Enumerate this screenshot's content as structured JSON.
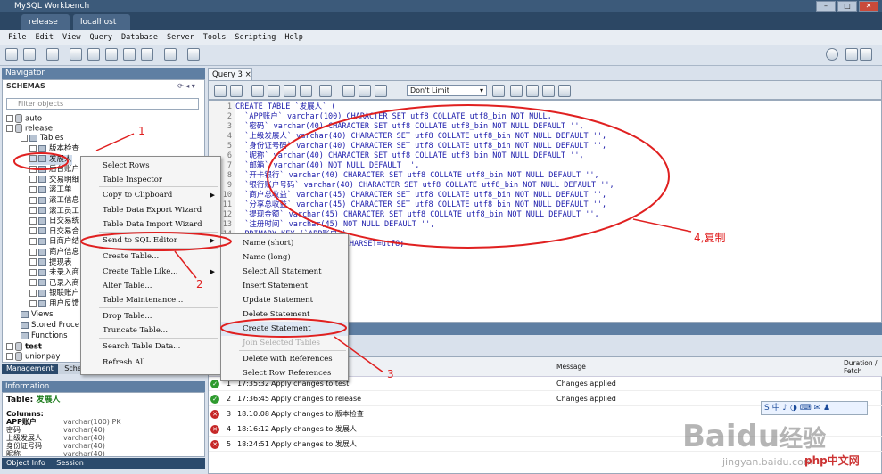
{
  "window": {
    "title": "MySQL Workbench"
  },
  "doc_tabs": [
    "release",
    "localhost"
  ],
  "menu": [
    "File",
    "Edit",
    "View",
    "Query",
    "Database",
    "Server",
    "Tools",
    "Scripting",
    "Help"
  ],
  "navigator": {
    "title": "Navigator",
    "schemas_label": "SCHEMAS",
    "filter_placeholder": "Filter objects",
    "schemas": [
      {
        "name": "auto"
      },
      {
        "name": "release"
      },
      {
        "name": "Tables"
      }
    ],
    "tables": [
      "版本检查",
      "发展人",
      "后台账户",
      "交易明细",
      "滚工单",
      "滚工信息",
      "滚工员工",
      "日交易统",
      "日交易合",
      "日商户结",
      "商户信息",
      "提现表",
      "未录入商",
      "已录入商",
      "银联账户",
      "用户反馈"
    ],
    "sub_items": [
      "Views",
      "Stored Proce",
      "Functions"
    ],
    "other_schemas": [
      "test",
      "unionpay"
    ],
    "bottom_tabs": [
      "Management",
      "Schem"
    ]
  },
  "info": {
    "title": "Information",
    "table_label": "Table:",
    "table_name": "发展人",
    "columns_label": "Columns:",
    "columns": [
      {
        "name": "APP账户",
        "type": "varchar(100) PK"
      },
      {
        "name": "密码",
        "type": "varchar(40)"
      },
      {
        "name": "上级发展人",
        "type": "varchar(40)"
      },
      {
        "name": "身份证号码",
        "type": "varchar(40)"
      },
      {
        "name": "昵称",
        "type": "varchar(40)"
      }
    ],
    "bottom_tabs": [
      "Object Info",
      "Session"
    ]
  },
  "query": {
    "tab": "Query 3",
    "limit": "Don't Limit",
    "lines": [
      "CREATE TABLE `发展人` (",
      "  `APP账户` varchar(100) CHARACTER SET utf8 COLLATE utf8_bin NOT NULL,",
      "  `密码` varchar(40) CHARACTER SET utf8 COLLATE utf8_bin NOT NULL DEFAULT '',",
      "  `上级发展人` varchar(40) CHARACTER SET utf8 COLLATE utf8_bin NOT NULL DEFAULT '',",
      "  `身份证号码` varchar(40) CHARACTER SET utf8 COLLATE utf8_bin NOT NULL DEFAULT '',",
      "  `昵称` varchar(40) CHARACTER SET utf8 COLLATE utf8_bin NOT NULL DEFAULT '',",
      "  `邮箱` varchar(40) NOT NULL DEFAULT '',",
      "  `开卡银行` varchar(40) CHARACTER SET utf8 COLLATE utf8_bin NOT NULL DEFAULT '',",
      "  `银行账户号码` varchar(40) CHARACTER SET utf8 COLLATE utf8_bin NOT NULL DEFAULT '',",
      "  `商户总收益` varchar(45) CHARACTER SET utf8 COLLATE utf8_bin NOT NULL DEFAULT '',",
      "  `分享总收益` varchar(45) CHARACTER SET utf8 COLLATE utf8_bin NOT NULL DEFAULT '',",
      "  `提现金额` varchar(45) CHARACTER SET utf8 COLLATE utf8_bin NOT NULL DEFAULT '',",
      "  `注册时间` varchar(45) NOT NULL DEFAULT '',",
      "  PRIMARY KEY (`APP账户`)",
      ") ENGINE=InnoDB DEFAULT CHARSET=utf8;"
    ]
  },
  "output": {
    "columns": [
      "",
      "Message",
      "Duration / Fetch"
    ],
    "rows": [
      {
        "n": "1",
        "time": "17:35:32",
        "action": "Apply changes to test",
        "message": "Changes applied",
        "status": "ok"
      },
      {
        "n": "2",
        "time": "17:36:45",
        "action": "Apply changes to release",
        "message": "Changes applied",
        "status": "ok"
      },
      {
        "n": "3",
        "time": "18:10:08",
        "action": "Apply changes to 版本检查",
        "message": "",
        "status": "err"
      },
      {
        "n": "4",
        "time": "18:16:12",
        "action": "Apply changes to 发展人",
        "message": "",
        "status": "err"
      },
      {
        "n": "5",
        "time": "18:24:51",
        "action": "Apply changes to 发展人",
        "message": "",
        "status": "err"
      }
    ]
  },
  "context_menu": {
    "items": [
      "Select Rows",
      "Table Inspector",
      "Copy to Clipboard",
      "Table Data Export Wizard",
      "Table Data Import Wizard",
      "Send to SQL Editor",
      "Create Table...",
      "Create Table Like...",
      "Alter Table...",
      "Table Maintenance...",
      "Drop Table...",
      "Truncate Table...",
      "Search Table Data...",
      "Refresh All"
    ]
  },
  "submenu": {
    "items": [
      "Name (short)",
      "Name (long)",
      "Select All Statement",
      "Insert Statement",
      "Update Statement",
      "Delete Statement",
      "Create Statement",
      "Join Selected Tables",
      "Delete with References",
      "Select Row References"
    ]
  },
  "annotations": {
    "a1": "1",
    "a2": "2",
    "a3": "3",
    "a4": "4,复制"
  },
  "watermark": {
    "brand": "Baidu",
    "brand_cn": "经验",
    "url": "jingyan.baidu.com",
    "php": "php中文网"
  },
  "ime": {
    "text": "S 中 ♪ ◑ ⌨ ✉ ♟"
  },
  "colors": {
    "accent": "#e02020",
    "keyword": "#1a1aaa",
    "nav_head": "#5f7fa3"
  }
}
